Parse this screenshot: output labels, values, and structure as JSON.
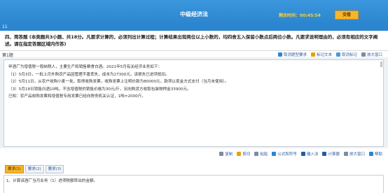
{
  "header": {
    "title": "中级经济法",
    "question_number": "11",
    "timer_label": "剩余时间：",
    "timer_value": "00:45:54",
    "submit_label": "交卷"
  },
  "section": {
    "heading": "四、简答题 (本类题共3小题，共18分。凡要求计算的，必须列出计算过程；计算结果出现两位以上小数的，均四舍五入保留小数点后两位小数。凡要求说明理由的，必须有相应的文字阐述。请在指定答题区域内作答)",
    "question_label": "第1题"
  },
  "top_tools": [
    {
      "label": "取消题型要求",
      "icon": "pin-icon",
      "color": "#2c86cf"
    },
    {
      "label": "标记文本",
      "icon": "pen-icon",
      "color": "#e8a100"
    },
    {
      "label": "取消标记",
      "icon": "undo-icon",
      "color": "#4a9bd8"
    },
    {
      "label": "放大窗口",
      "icon": "expand-icon",
      "color": "#7a8da3"
    }
  ],
  "question": {
    "lines": [
      "甲酒厂为增值税一般纳税人，主要生产和销售粮食白酒。2021年5月有关经济业务如下：",
      "（1）5月3日，一批上月外购农产品因管理不善丢失，成本为27300元，该损失已进项抵扣。",
      "（2）5月11日，从农户收购小麦一批，取得收购发票，收购发票上注明价款为80000元，款项以现金方式支付（当月未使用）。",
      "（3）5月18日销售白酒10吨，不含增值税的销售价格为30元/斤，另向购货方收取包装物押金33900元。",
      "已知：农产品收购发票和增值税专用发票已经向税务机关认证，1吨=2000斤。"
    ]
  },
  "bottom_tools": [
    {
      "label": "复制",
      "icon": "copy-icon",
      "color": "#7a8da3"
    },
    {
      "label": "剪切",
      "icon": "cut-icon",
      "color": "#e8a100"
    },
    {
      "label": "粘贴",
      "icon": "paste-icon",
      "color": "#7a8da3"
    },
    {
      "label": "公式和符号",
      "icon": "formula-icon",
      "color": "#2c86cf"
    },
    {
      "label": "输入法",
      "icon": "keyboard-icon",
      "color": "#1f5fa8"
    },
    {
      "label": "计算器",
      "icon": "calculator-icon",
      "color": "#1f5fa8"
    },
    {
      "label": "放大窗口",
      "icon": "expand-icon",
      "color": "#7a8da3"
    },
    {
      "label": "帮助",
      "icon": "help-icon",
      "color": "#2c86cf"
    }
  ],
  "answer_tabs": [
    {
      "label": "要求(1)",
      "active": true
    },
    {
      "label": "要求(2)",
      "active": false
    },
    {
      "label": "要求(3)",
      "active": false
    }
  ],
  "answer": {
    "prompt": "1、计算该酒厂当月业务（1）进项税额转出的金额。"
  }
}
